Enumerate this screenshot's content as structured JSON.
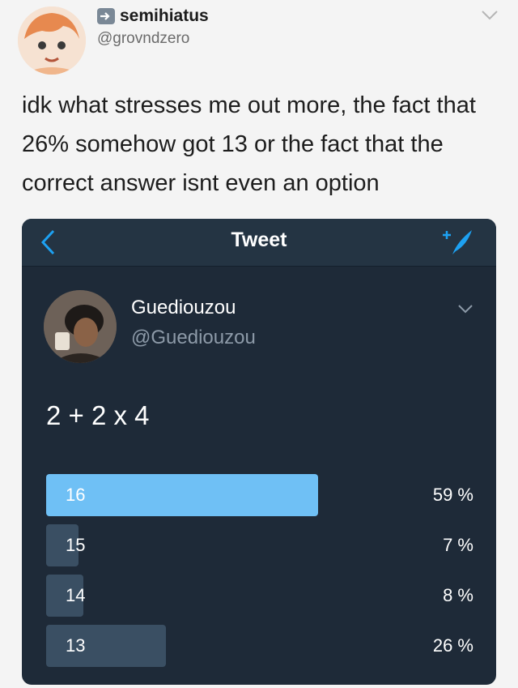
{
  "outer_tweet": {
    "display_name": "semihiatus",
    "handle": "@grovndzero",
    "text": "idk what stresses me out more, the fact that 26% somehow got 13 or the fact that the correct answer isnt even an option"
  },
  "embedded": {
    "nav": {
      "title": "Tweet"
    },
    "author": {
      "display_name": "Guediouzou",
      "handle": "@Guediouzou"
    },
    "question": "2 + 2 x 4",
    "poll": [
      {
        "label": "16",
        "percent_text": "59 %",
        "value": 59,
        "winner": true
      },
      {
        "label": "15",
        "percent_text": "7 %",
        "value": 7,
        "winner": false
      },
      {
        "label": "14",
        "percent_text": "8 %",
        "value": 8,
        "winner": false
      },
      {
        "label": "13",
        "percent_text": "26 %",
        "value": 26,
        "winner": false
      }
    ]
  },
  "colors": {
    "embedded_background": "#1e2a38",
    "poll_winner_bar": "#6fc0f5",
    "poll_bar": "#3a4f63",
    "accent": "#1da1f2"
  },
  "icons": [
    "retweet-icon",
    "chevron-down-icon",
    "back-arrow-icon",
    "compose-tweet-icon"
  ]
}
